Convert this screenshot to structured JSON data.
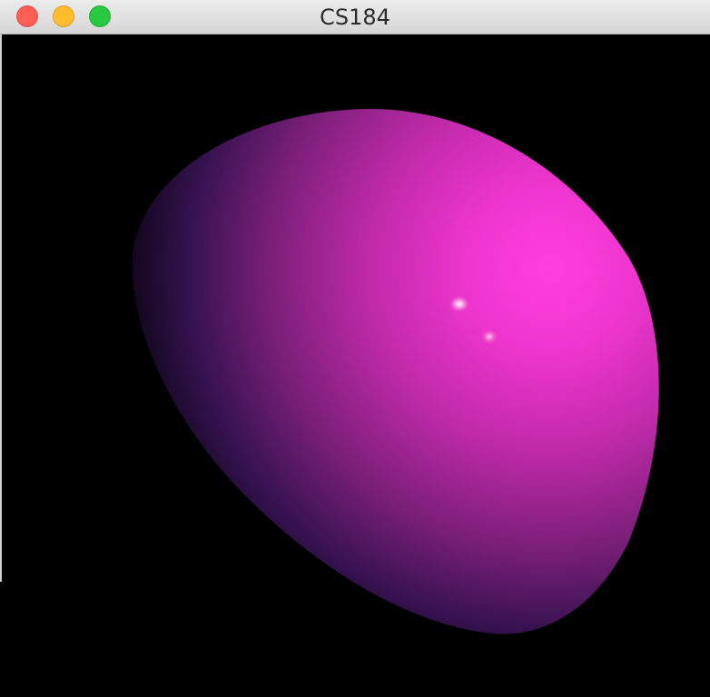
{
  "window": {
    "title": "CS184"
  },
  "controls": {
    "close": "close-icon",
    "minimize": "minimize-icon",
    "zoom": "zoom-icon"
  },
  "scene": {
    "object": "sphere",
    "background": "#000000",
    "colors": {
      "highlight": "#ff44dd",
      "mid": "#c42fb8",
      "shadow": "#3a1258",
      "dark": "#12061a"
    },
    "specular_highlights": 2
  }
}
